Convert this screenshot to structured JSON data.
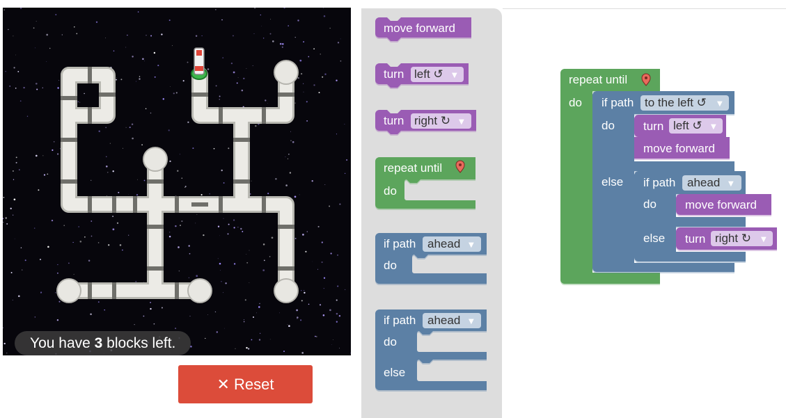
{
  "status": {
    "prefix": "You have ",
    "count": "3",
    "suffix": " blocks left."
  },
  "reset": {
    "icon": "✕",
    "label": "Reset"
  },
  "toolbox": {
    "move_forward": "move forward",
    "turn1": {
      "label": "turn",
      "value": "left ↺"
    },
    "turn2": {
      "label": "turn",
      "value": "right ↻"
    },
    "repeat": {
      "label": "repeat until",
      "do": "do"
    },
    "if1": {
      "label": "if path",
      "value": "ahead",
      "do": "do"
    },
    "if2": {
      "label": "if path",
      "value": "ahead",
      "do": "do",
      "else": "else"
    }
  },
  "program": {
    "repeat_label": "repeat until",
    "repeat_do": "do",
    "if_outer_label": "if path",
    "if_outer_value": "to the left ↺",
    "if_outer_do": "do",
    "turn_left_label": "turn",
    "turn_left_value": "left ↺",
    "move1": "move forward",
    "if_outer_else": "else",
    "if_inner_label": "if path",
    "if_inner_value": "ahead",
    "if_inner_do": "do",
    "move2": "move forward",
    "if_inner_else": "else",
    "turn_right_label": "turn",
    "turn_right_value": "right ↻"
  },
  "colors": {
    "action": "#9a5cb4",
    "loop": "#5ba55b",
    "logic": "#5b80a5",
    "reset": "#dc4c3a",
    "toolbox_bg": "#dddddd"
  }
}
